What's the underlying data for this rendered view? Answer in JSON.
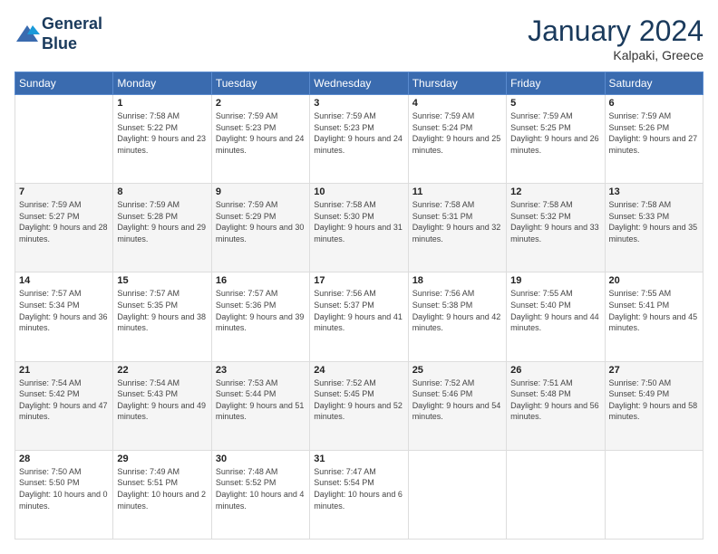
{
  "logo": {
    "line1": "General",
    "line2": "Blue"
  },
  "header": {
    "month": "January 2024",
    "location": "Kalpaki, Greece"
  },
  "weekdays": [
    "Sunday",
    "Monday",
    "Tuesday",
    "Wednesday",
    "Thursday",
    "Friday",
    "Saturday"
  ],
  "rows": [
    [
      {
        "day": "",
        "sunrise": "",
        "sunset": "",
        "daylight": ""
      },
      {
        "day": "1",
        "sunrise": "Sunrise: 7:58 AM",
        "sunset": "Sunset: 5:22 PM",
        "daylight": "Daylight: 9 hours and 23 minutes."
      },
      {
        "day": "2",
        "sunrise": "Sunrise: 7:59 AM",
        "sunset": "Sunset: 5:23 PM",
        "daylight": "Daylight: 9 hours and 24 minutes."
      },
      {
        "day": "3",
        "sunrise": "Sunrise: 7:59 AM",
        "sunset": "Sunset: 5:23 PM",
        "daylight": "Daylight: 9 hours and 24 minutes."
      },
      {
        "day": "4",
        "sunrise": "Sunrise: 7:59 AM",
        "sunset": "Sunset: 5:24 PM",
        "daylight": "Daylight: 9 hours and 25 minutes."
      },
      {
        "day": "5",
        "sunrise": "Sunrise: 7:59 AM",
        "sunset": "Sunset: 5:25 PM",
        "daylight": "Daylight: 9 hours and 26 minutes."
      },
      {
        "day": "6",
        "sunrise": "Sunrise: 7:59 AM",
        "sunset": "Sunset: 5:26 PM",
        "daylight": "Daylight: 9 hours and 27 minutes."
      }
    ],
    [
      {
        "day": "7",
        "sunrise": "Sunrise: 7:59 AM",
        "sunset": "Sunset: 5:27 PM",
        "daylight": "Daylight: 9 hours and 28 minutes."
      },
      {
        "day": "8",
        "sunrise": "Sunrise: 7:59 AM",
        "sunset": "Sunset: 5:28 PM",
        "daylight": "Daylight: 9 hours and 29 minutes."
      },
      {
        "day": "9",
        "sunrise": "Sunrise: 7:59 AM",
        "sunset": "Sunset: 5:29 PM",
        "daylight": "Daylight: 9 hours and 30 minutes."
      },
      {
        "day": "10",
        "sunrise": "Sunrise: 7:58 AM",
        "sunset": "Sunset: 5:30 PM",
        "daylight": "Daylight: 9 hours and 31 minutes."
      },
      {
        "day": "11",
        "sunrise": "Sunrise: 7:58 AM",
        "sunset": "Sunset: 5:31 PM",
        "daylight": "Daylight: 9 hours and 32 minutes."
      },
      {
        "day": "12",
        "sunrise": "Sunrise: 7:58 AM",
        "sunset": "Sunset: 5:32 PM",
        "daylight": "Daylight: 9 hours and 33 minutes."
      },
      {
        "day": "13",
        "sunrise": "Sunrise: 7:58 AM",
        "sunset": "Sunset: 5:33 PM",
        "daylight": "Daylight: 9 hours and 35 minutes."
      }
    ],
    [
      {
        "day": "14",
        "sunrise": "Sunrise: 7:57 AM",
        "sunset": "Sunset: 5:34 PM",
        "daylight": "Daylight: 9 hours and 36 minutes."
      },
      {
        "day": "15",
        "sunrise": "Sunrise: 7:57 AM",
        "sunset": "Sunset: 5:35 PM",
        "daylight": "Daylight: 9 hours and 38 minutes."
      },
      {
        "day": "16",
        "sunrise": "Sunrise: 7:57 AM",
        "sunset": "Sunset: 5:36 PM",
        "daylight": "Daylight: 9 hours and 39 minutes."
      },
      {
        "day": "17",
        "sunrise": "Sunrise: 7:56 AM",
        "sunset": "Sunset: 5:37 PM",
        "daylight": "Daylight: 9 hours and 41 minutes."
      },
      {
        "day": "18",
        "sunrise": "Sunrise: 7:56 AM",
        "sunset": "Sunset: 5:38 PM",
        "daylight": "Daylight: 9 hours and 42 minutes."
      },
      {
        "day": "19",
        "sunrise": "Sunrise: 7:55 AM",
        "sunset": "Sunset: 5:40 PM",
        "daylight": "Daylight: 9 hours and 44 minutes."
      },
      {
        "day": "20",
        "sunrise": "Sunrise: 7:55 AM",
        "sunset": "Sunset: 5:41 PM",
        "daylight": "Daylight: 9 hours and 45 minutes."
      }
    ],
    [
      {
        "day": "21",
        "sunrise": "Sunrise: 7:54 AM",
        "sunset": "Sunset: 5:42 PM",
        "daylight": "Daylight: 9 hours and 47 minutes."
      },
      {
        "day": "22",
        "sunrise": "Sunrise: 7:54 AM",
        "sunset": "Sunset: 5:43 PM",
        "daylight": "Daylight: 9 hours and 49 minutes."
      },
      {
        "day": "23",
        "sunrise": "Sunrise: 7:53 AM",
        "sunset": "Sunset: 5:44 PM",
        "daylight": "Daylight: 9 hours and 51 minutes."
      },
      {
        "day": "24",
        "sunrise": "Sunrise: 7:52 AM",
        "sunset": "Sunset: 5:45 PM",
        "daylight": "Daylight: 9 hours and 52 minutes."
      },
      {
        "day": "25",
        "sunrise": "Sunrise: 7:52 AM",
        "sunset": "Sunset: 5:46 PM",
        "daylight": "Daylight: 9 hours and 54 minutes."
      },
      {
        "day": "26",
        "sunrise": "Sunrise: 7:51 AM",
        "sunset": "Sunset: 5:48 PM",
        "daylight": "Daylight: 9 hours and 56 minutes."
      },
      {
        "day": "27",
        "sunrise": "Sunrise: 7:50 AM",
        "sunset": "Sunset: 5:49 PM",
        "daylight": "Daylight: 9 hours and 58 minutes."
      }
    ],
    [
      {
        "day": "28",
        "sunrise": "Sunrise: 7:50 AM",
        "sunset": "Sunset: 5:50 PM",
        "daylight": "Daylight: 10 hours and 0 minutes."
      },
      {
        "day": "29",
        "sunrise": "Sunrise: 7:49 AM",
        "sunset": "Sunset: 5:51 PM",
        "daylight": "Daylight: 10 hours and 2 minutes."
      },
      {
        "day": "30",
        "sunrise": "Sunrise: 7:48 AM",
        "sunset": "Sunset: 5:52 PM",
        "daylight": "Daylight: 10 hours and 4 minutes."
      },
      {
        "day": "31",
        "sunrise": "Sunrise: 7:47 AM",
        "sunset": "Sunset: 5:54 PM",
        "daylight": "Daylight: 10 hours and 6 minutes."
      },
      {
        "day": "",
        "sunrise": "",
        "sunset": "",
        "daylight": ""
      },
      {
        "day": "",
        "sunrise": "",
        "sunset": "",
        "daylight": ""
      },
      {
        "day": "",
        "sunrise": "",
        "sunset": "",
        "daylight": ""
      }
    ]
  ]
}
